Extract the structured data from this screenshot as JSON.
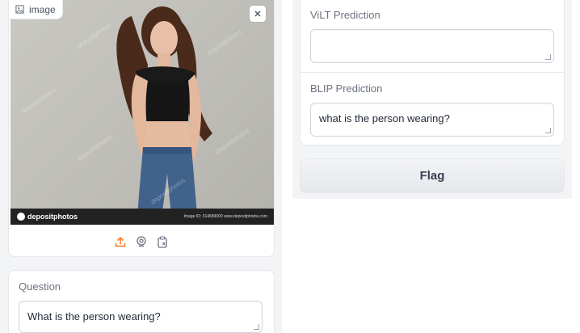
{
  "image_input": {
    "label": "image",
    "photo_logo": "depositphotos",
    "photo_id": "Image ID: 314689000    www.depositphotos.com",
    "watermark": "depositphotos"
  },
  "upload_tools": [
    "upload-icon",
    "webcam-icon",
    "clipboard-icon"
  ],
  "question": {
    "label": "Question",
    "value": "What is the person wearing?"
  },
  "outputs": {
    "vilt_label": "ViLT Prediction",
    "vilt_value": "",
    "blip_label": "BLIP Prediction",
    "blip_value": "what is the person wearing?"
  },
  "flag_button": {
    "label": "Flag"
  },
  "colors": {
    "accent": "#f97316",
    "panel_bg": "#f3f4f6",
    "border": "#e5e7eb"
  }
}
